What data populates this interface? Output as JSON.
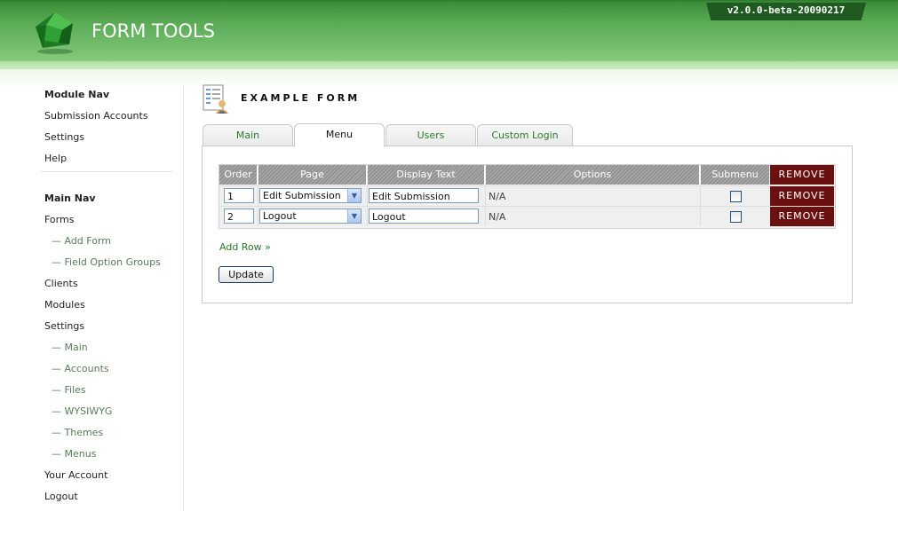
{
  "app": {
    "title": "FORM TOOLS",
    "version": "v2.0.0-beta-20090217"
  },
  "nav": {
    "module_nav_heading": "Module Nav",
    "module_items": [
      "Submission Accounts",
      "Settings",
      "Help"
    ],
    "main_nav_heading": "Main Nav",
    "main_items": [
      {
        "label": "Forms",
        "sub": false
      },
      {
        "label": "— Add Form",
        "sub": true
      },
      {
        "label": "— Field Option Groups",
        "sub": true
      },
      {
        "label": "Clients",
        "sub": false
      },
      {
        "label": "Modules",
        "sub": false
      },
      {
        "label": "Settings",
        "sub": false
      },
      {
        "label": "— Main",
        "sub": true
      },
      {
        "label": "— Accounts",
        "sub": true
      },
      {
        "label": "— Files",
        "sub": true
      },
      {
        "label": "— WYSIWYG",
        "sub": true
      },
      {
        "label": "— Themes",
        "sub": true
      },
      {
        "label": "— Menus",
        "sub": true
      },
      {
        "label": "Your Account",
        "sub": false
      },
      {
        "label": "Logout",
        "sub": false
      }
    ]
  },
  "page": {
    "title": "EXAMPLE FORM",
    "icon": "form-document-icon"
  },
  "tabs": [
    {
      "label": "Main",
      "active": false
    },
    {
      "label": "Menu",
      "active": true
    },
    {
      "label": "Users",
      "active": false
    },
    {
      "label": "Custom Login",
      "active": false
    }
  ],
  "table": {
    "headers": {
      "order": "Order",
      "page": "Page",
      "display_text": "Display Text",
      "options": "Options",
      "submenu": "Submenu",
      "remove": "REMOVE"
    },
    "rows": [
      {
        "order": "1",
        "page": "Edit Submission",
        "display_text": "Edit Submission",
        "options": "N/A",
        "submenu": false,
        "remove": "REMOVE"
      },
      {
        "order": "2",
        "page": "Logout",
        "display_text": "Logout",
        "options": "N/A",
        "submenu": false,
        "remove": "REMOVE"
      }
    ]
  },
  "actions": {
    "add_row": "Add Row »",
    "update": "Update"
  },
  "colors": {
    "brand_green": "#4a9a45",
    "remove_red": "#6b1010",
    "link_green": "#2b7a2b"
  }
}
